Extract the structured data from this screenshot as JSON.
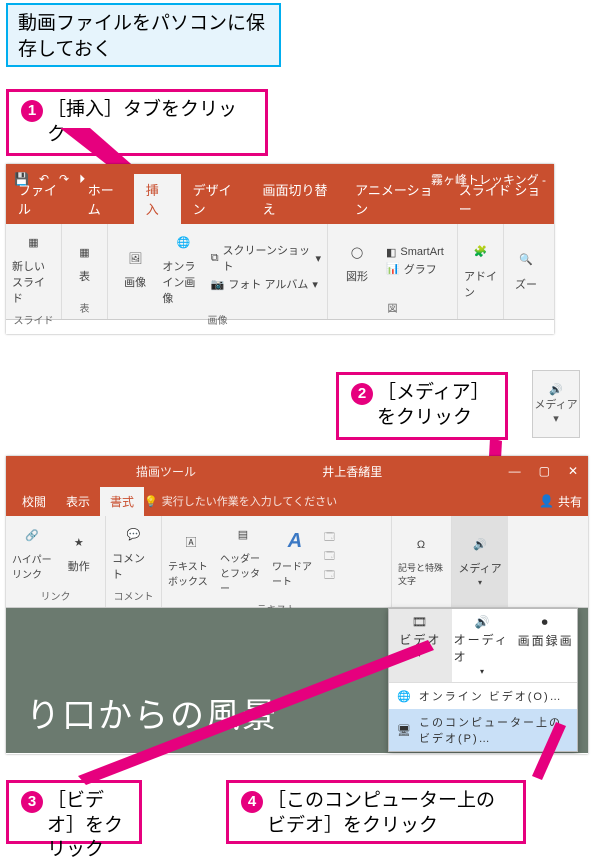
{
  "intro_note": "動画ファイルをパソコンに保存しておく",
  "callouts": {
    "c1": "［挿入］タブをクリック",
    "c2": "［メディア］をクリック",
    "c3": "［ビデオ］をクリック",
    "c4": "［このコンピューター上のビデオ］をクリック"
  },
  "shot1": {
    "doc_title": "霧ヶ峰トレッキング -",
    "tabs": {
      "file": "ファイル",
      "home": "ホーム",
      "insert": "挿入",
      "design": "デザイン",
      "transitions": "画面切り替え",
      "animations": "アニメーション",
      "slideshow": "スライド ショー"
    },
    "ribbon": {
      "new_slide": "新しいスライド",
      "table": "表",
      "images": "画像",
      "online_images": "オンライン画像",
      "screenshot": "スクリーンショット",
      "photo_album": "フォト アルバム",
      "shapes": "図形",
      "smartart": "SmartArt",
      "chart": "グラフ",
      "addins": "アドイン",
      "zoom": "ズー",
      "group_slide": "スライド",
      "group_table": "表",
      "group_images": "画像",
      "group_illustrations": "図"
    }
  },
  "media_chunk": {
    "label": "メディア"
  },
  "shot2": {
    "titlebar": {
      "tool_context": "描画ツール",
      "user": "井上香緒里"
    },
    "tabs": {
      "review": "校閲",
      "view": "表示",
      "format": "書式",
      "tell_me": "実行したい作業を入力してください",
      "share": "共有"
    },
    "ribbon": {
      "hyperlink": "ハイパーリンク",
      "action": "動作",
      "comment": "コメント",
      "textbox": "テキストボックス",
      "header_footer": "ヘッダーとフッター",
      "wordart": "ワードアート",
      "symbols": "記号と特殊文字",
      "media": "メディア",
      "group_link": "リンク",
      "group_comment": "コメント",
      "group_text": "テキスト"
    },
    "slide_text": "り口からの風景",
    "media_menu": {
      "video": "ビデオ",
      "audio": "オーディオ",
      "screen_rec": "画面録画",
      "online_video": "オンライン ビデオ(O)…",
      "this_pc_video": "このコンピューター上のビデオ(P)…"
    }
  }
}
